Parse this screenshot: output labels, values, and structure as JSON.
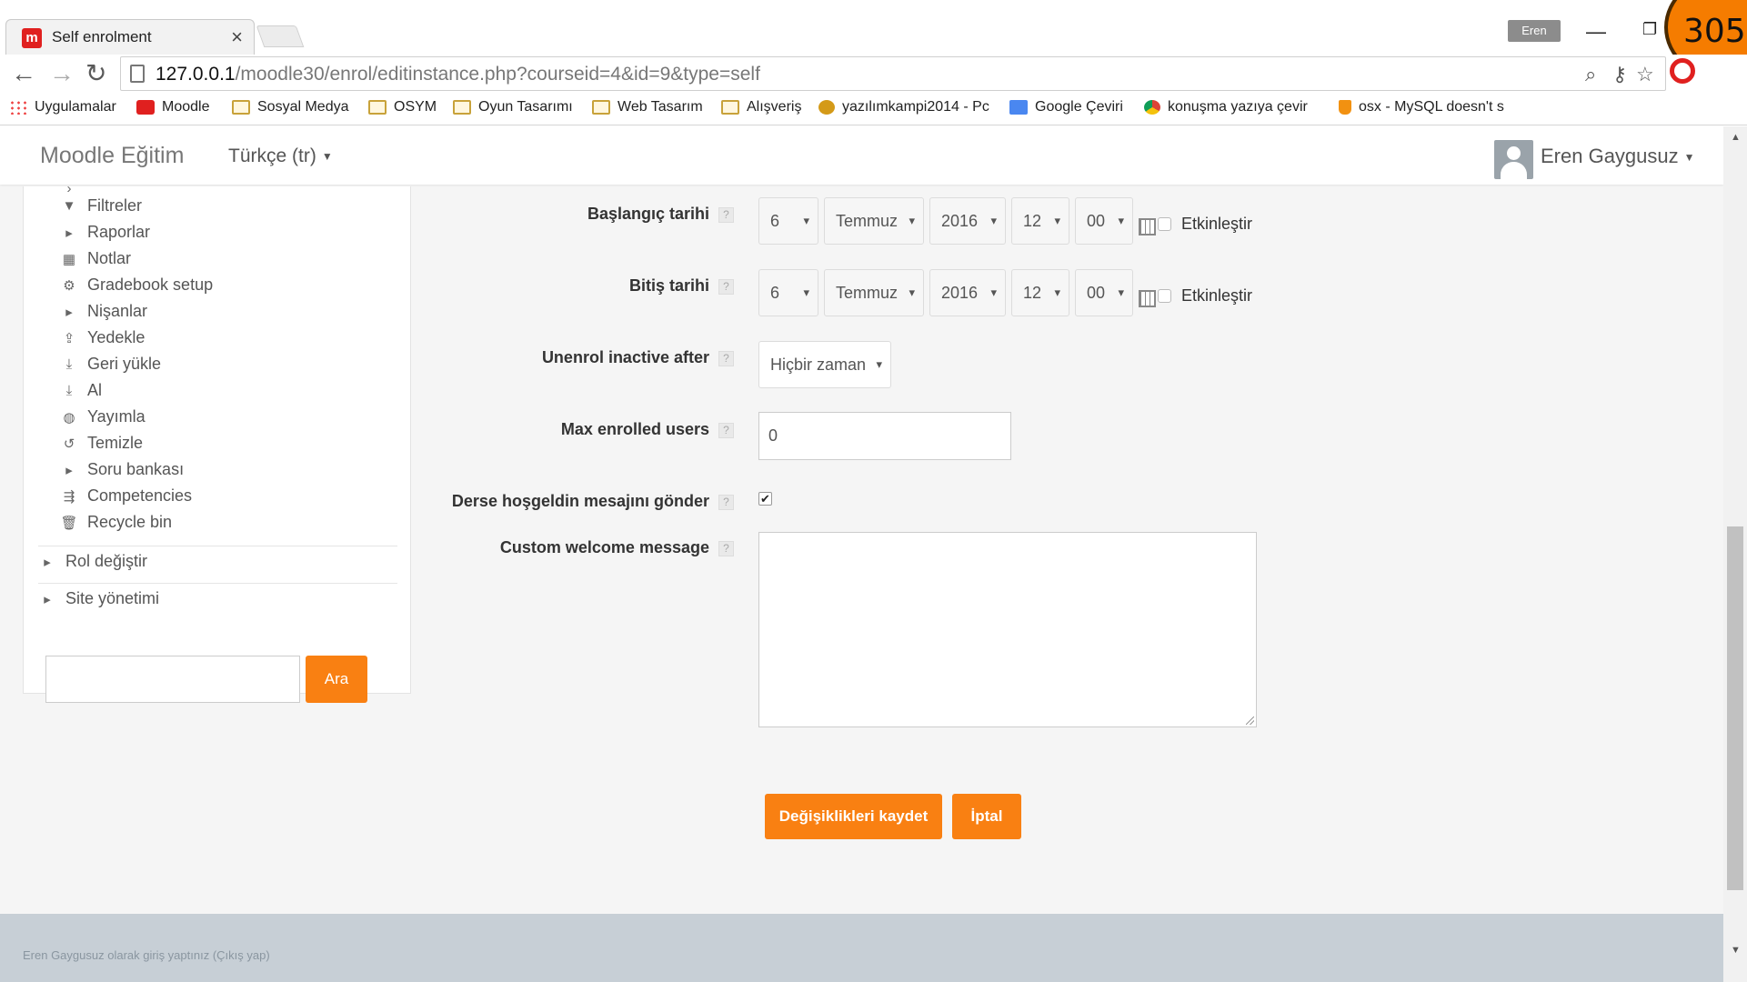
{
  "browser": {
    "tab_title": "Self enrolment",
    "tab_close": "×",
    "profile": "Eren",
    "url_host": "127.0.0.1",
    "url_path": "/moodle30/enrol/editinstance.php?courseid=4&id=9&type=self",
    "counter": "305"
  },
  "bookmarks": [
    {
      "label": "Uygulamalar",
      "icon": "apps-icon"
    },
    {
      "label": "Moodle",
      "icon": "moodle-icon"
    },
    {
      "label": "Sosyal Medya",
      "icon": "folder-icon"
    },
    {
      "label": "OSYM",
      "icon": "folder-icon"
    },
    {
      "label": "Oyun Tasarımı",
      "icon": "folder-icon"
    },
    {
      "label": "Web Tasarım",
      "icon": "folder-icon"
    },
    {
      "label": "Alışveriş",
      "icon": "folder-icon"
    },
    {
      "label": "yazılımkampi2014 - Pc",
      "icon": "paw-icon"
    },
    {
      "label": "Google Çeviri",
      "icon": "translate-icon"
    },
    {
      "label": "konuşma yazıya çevir",
      "icon": "chrome-icon"
    },
    {
      "label": "osx - MySQL doesn't s",
      "icon": "java-icon"
    }
  ],
  "header": {
    "brand": "Moodle Eğitim",
    "language": "Türkçe (tr)",
    "user": "Eren Gaygusuz"
  },
  "sidebar": {
    "items": [
      {
        "label": "Filtreler",
        "icon": "filter-icon"
      },
      {
        "label": "Raporlar",
        "icon": "expand-arrow-icon"
      },
      {
        "label": "Notlar",
        "icon": "grades-icon"
      },
      {
        "label": "Gradebook setup",
        "icon": "gear-icon"
      },
      {
        "label": "Nişanlar",
        "icon": "expand-arrow-icon"
      },
      {
        "label": "Yedekle",
        "icon": "upload-icon"
      },
      {
        "label": "Geri yükle",
        "icon": "download-icon"
      },
      {
        "label": "Al",
        "icon": "download-icon"
      },
      {
        "label": "Yayımla",
        "icon": "globe-icon"
      },
      {
        "label": "Temizle",
        "icon": "reset-icon"
      },
      {
        "label": "Soru bankası",
        "icon": "expand-arrow-icon"
      },
      {
        "label": "Competencies",
        "icon": "competencies-icon"
      },
      {
        "label": "Recycle bin",
        "icon": "trash-icon"
      }
    ],
    "switch_role": "Rol değiştir",
    "site_admin": "Site yönetimi",
    "search_button": "Ara"
  },
  "form": {
    "start_date": {
      "label": "Başlangıç tarihi",
      "day": "6",
      "month": "Temmuz",
      "year": "2016",
      "hour": "12",
      "minute": "00",
      "enable_label": "Etkinleştir"
    },
    "end_date": {
      "label": "Bitiş tarihi",
      "day": "6",
      "month": "Temmuz",
      "year": "2016",
      "hour": "12",
      "minute": "00",
      "enable_label": "Etkinleştir"
    },
    "unenrol_inactive": {
      "label": "Unenrol inactive after",
      "value": "Hiçbir zaman"
    },
    "max_enrolled": {
      "label": "Max enrolled users",
      "value": "0"
    },
    "send_welcome": {
      "label": "Derse hoşgeldin mesajını gönder",
      "checked": true
    },
    "custom_welcome": {
      "label": "Custom welcome message",
      "value": ""
    },
    "save_button": "Değişiklikleri kaydet",
    "cancel_button": "İptal"
  },
  "footer": {
    "login_info": "Eren Gaygusuz olarak giriş yaptınız (Çıkış yap)"
  },
  "colors": {
    "accent": "#f98012",
    "footer_bg": "#c7cfd6"
  }
}
